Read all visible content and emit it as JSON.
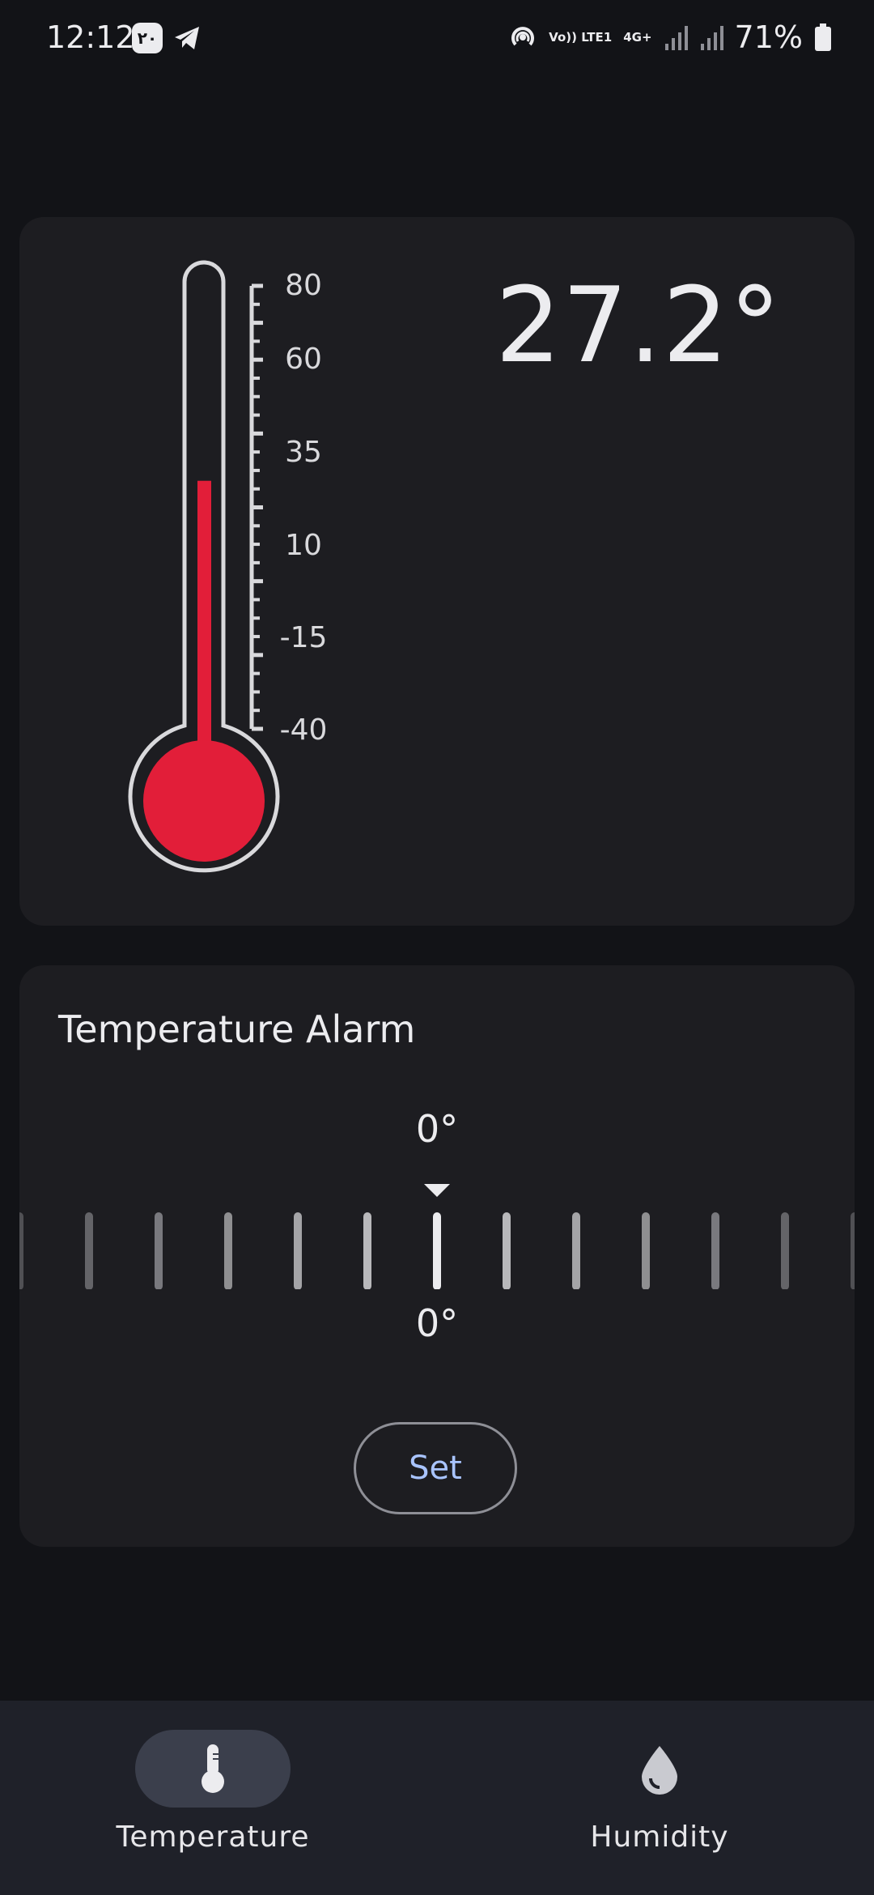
{
  "status_bar": {
    "time": "12:12",
    "badge_text": "٢٠",
    "network_volte": "Vo)) LTE1",
    "network_4g": "4G+",
    "battery_percent": "71%"
  },
  "thermometer": {
    "scale_labels": [
      "80",
      "60",
      "35",
      "10",
      "-15",
      "-40"
    ],
    "reading": "27.2°",
    "level_value": 27.2,
    "scale_min": -40,
    "scale_max": 80,
    "mercury_color": "#e21e39"
  },
  "alarm": {
    "title": "Temperature Alarm",
    "value_top": "0°",
    "value_bottom": "0°",
    "set_label": "Set"
  },
  "bottom_nav": {
    "items": [
      {
        "label": "Temperature",
        "icon": "thermometer-icon",
        "active": true
      },
      {
        "label": "Humidity",
        "icon": "droplet-icon",
        "active": false
      }
    ]
  },
  "colors": {
    "accent": "#a9c4ff",
    "background": "#121317",
    "card": "#1d1d21"
  }
}
